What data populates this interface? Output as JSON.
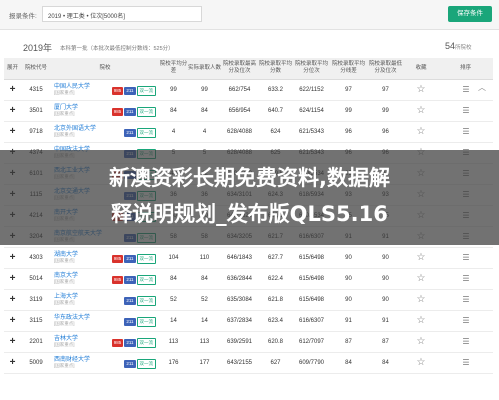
{
  "filter": {
    "label": "报录条件:",
    "value": "2019 • 理工类 • 位次[5000名]",
    "save_button": "保存条件"
  },
  "year_bar": {
    "year": "2019年",
    "batch": "本科第一批（本批次最低控制分数线：525分）",
    "count": "54",
    "count_unit": "所院校"
  },
  "table": {
    "headers": [
      "展开",
      "院校代号",
      "院校",
      "院校平均分差",
      "实际录取人数",
      "院校录取最高分及位次",
      "院校录取平均分数",
      "院校录取平均分位次",
      "院校录取平均分线差",
      "院校录取最低分及位次",
      "收藏",
      "排序"
    ],
    "rows": [
      {
        "code": "4315",
        "name": "中国人民大学",
        "sub": "[国家重点]",
        "tags": [
          "985",
          "211",
          "双一流"
        ],
        "diff": "99",
        "num": "99",
        "high": "662/754",
        "avg": "633.2",
        "low": "622/1152",
        "line": "97"
      },
      {
        "code": "3501",
        "name": "厦门大学",
        "sub": "[国家重点]",
        "tags": [
          "985",
          "211",
          "双一流"
        ],
        "diff": "84",
        "num": "84",
        "high": "656/954",
        "avg": "640.7",
        "low": "624/1154",
        "line": "99"
      },
      {
        "code": "9718",
        "name": "北京外国语大学",
        "sub": "[国家重点]",
        "tags": [
          "211",
          "双一流"
        ],
        "diff": "4",
        "num": "4",
        "high": "628/4088",
        "avg": "624",
        "low": "621/5343",
        "line": "96"
      },
      {
        "code": "4374",
        "name": "中国政法大学",
        "sub": "[国家重点]",
        "tags": [
          "211",
          "双一流"
        ],
        "diff": "5",
        "num": "5",
        "high": "628/4088",
        "avg": "625",
        "low": "621/5343",
        "line": "96"
      },
      {
        "code": "6101",
        "name": "西北工业大学",
        "sub": "[国家重点]",
        "tags": [
          "985",
          "211",
          "双一流"
        ],
        "diff": "42",
        "num": "42",
        "high": "640/2210",
        "avg": "629.5",
        "low": "620/5534",
        "line": "95"
      },
      {
        "code": "1115",
        "name": "北京交通大学",
        "sub": "[国家重点]",
        "tags": [
          "211",
          "双一流"
        ],
        "diff": "36",
        "num": "36",
        "high": "634/3101",
        "avg": "624.3",
        "low": "618/5934",
        "line": "93"
      },
      {
        "code": "4214",
        "name": "南开大学",
        "sub": "[国家重点]",
        "tags": [
          "985",
          "211",
          "双一流"
        ],
        "diff": "60",
        "num": "60",
        "high": "648/1521",
        "avg": "631.1",
        "low": "620/5534",
        "line": "95"
      },
      {
        "code": "3204",
        "name": "南京航空航天大学",
        "sub": "[国家重点]",
        "tags": [
          "211",
          "双一流"
        ],
        "diff": "58",
        "num": "58",
        "high": "634/3205",
        "avg": "621.7",
        "low": "616/6307",
        "line": "91"
      },
      {
        "code": "4303",
        "name": "湖南大学",
        "sub": "[国家重点]",
        "tags": [
          "985",
          "211",
          "双一流"
        ],
        "diff": "104",
        "num": "110",
        "high": "646/1843",
        "avg": "627.7",
        "low": "615/6498",
        "line": "90"
      },
      {
        "code": "5014",
        "name": "南京大学",
        "sub": "[国家重点]",
        "tags": [
          "985",
          "211",
          "双一流"
        ],
        "diff": "84",
        "num": "84",
        "high": "636/2844",
        "avg": "622.4",
        "low": "615/6498",
        "line": "90"
      },
      {
        "code": "3119",
        "name": "上海大学",
        "sub": "[国家重点]",
        "tags": [
          "211",
          "双一流"
        ],
        "diff": "52",
        "num": "52",
        "high": "635/3084",
        "avg": "621.8",
        "low": "615/6498",
        "line": "90"
      },
      {
        "code": "3115",
        "name": "华东政法大学",
        "sub": "[国家重点]",
        "tags": [
          "211",
          "双一流"
        ],
        "diff": "14",
        "num": "14",
        "high": "637/2834",
        "avg": "623.4",
        "low": "616/6307",
        "line": "91"
      },
      {
        "code": "2201",
        "name": "吉林大学",
        "sub": "[国家重点]",
        "tags": [
          "985",
          "211",
          "双一流"
        ],
        "diff": "113",
        "num": "113",
        "high": "639/2591",
        "avg": "620.8",
        "low": "612/7097",
        "line": "87"
      },
      {
        "code": "5009",
        "name": "西南财经大学",
        "sub": "[国家重点]",
        "tags": [
          "211",
          "双一流"
        ],
        "diff": "176",
        "num": "177",
        "high": "643/2155",
        "avg": "627",
        "low": "609/7790",
        "line": "84"
      }
    ]
  },
  "banner": {
    "line1": "新澳资彩长期免费资料,数据解",
    "line2": "释说明规划_发布版QLS5.16"
  },
  "icons": {
    "expand": "plus-icon",
    "favorite": "star-icon",
    "sort": "drag-handle-icon",
    "collapse": "chevron-up-icon"
  },
  "colors": {
    "accent": "#1aa67a",
    "link": "#1d7bd6",
    "tag985": "#d9322c",
    "tag211": "#3d63b8"
  }
}
